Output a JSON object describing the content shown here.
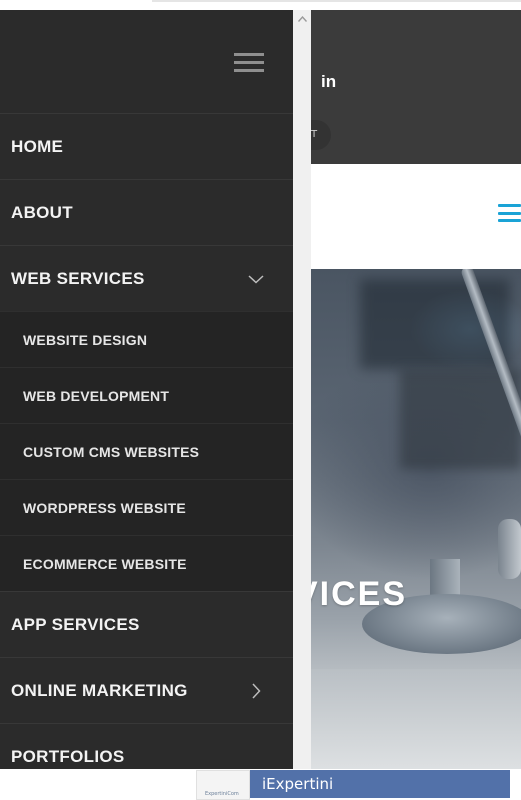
{
  "page": {
    "social_icon": "in",
    "topbar_pill_text": "T",
    "hero_title": "VICES"
  },
  "drawer": {
    "toggle_icon": "hamburger-icon",
    "items": [
      {
        "label": "HOME"
      },
      {
        "label": "ABOUT"
      },
      {
        "label": "WEB SERVICES",
        "expanded": true,
        "icon": "chevron-down-icon"
      },
      {
        "label": "APP SERVICES"
      },
      {
        "label": "ONLINE MARKETING",
        "icon": "chevron-right-icon"
      },
      {
        "label": "PORTFOLIOS"
      }
    ],
    "web_services_submenu": [
      {
        "label": "WEBSITE DESIGN"
      },
      {
        "label": "WEB DEVELOPMENT"
      },
      {
        "label": "CUSTOM CMS WEBSITES"
      },
      {
        "label": "WORDPRESS WEBSITE"
      },
      {
        "label": "ECOMMERCE WEBSITE"
      }
    ]
  },
  "taskbar": {
    "thumbnail_caption": "ExpertiniCom",
    "window_title": "iExpertini"
  },
  "colors": {
    "drawer_bg": "#2b2b2b",
    "submenu_bg": "#242424",
    "accent": "#1aa3d6",
    "taskbar": "#5271a9"
  }
}
